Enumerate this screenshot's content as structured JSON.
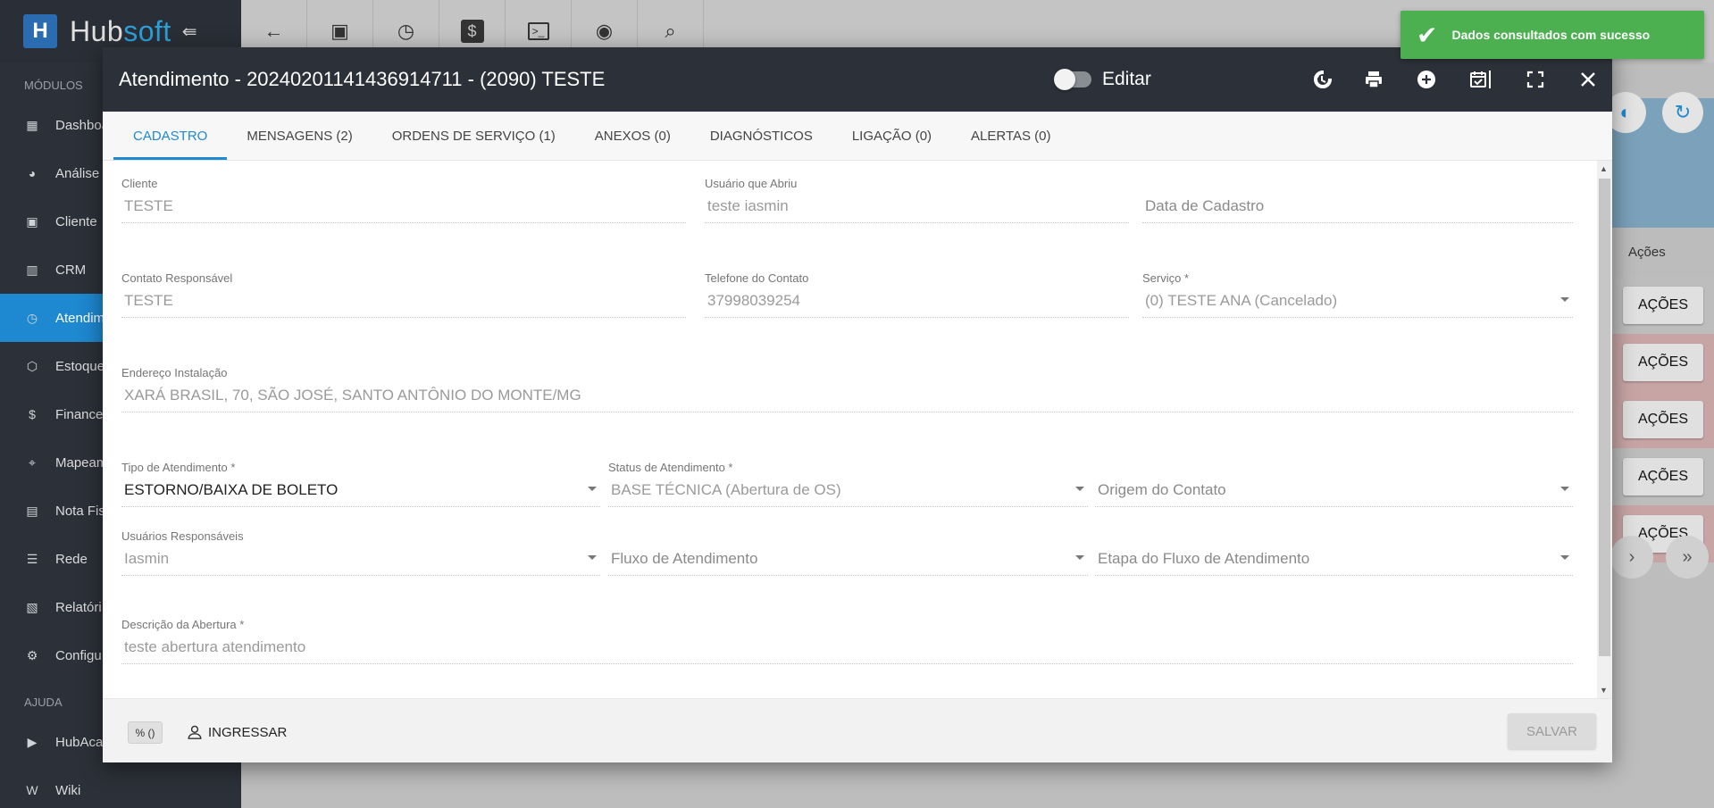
{
  "app": {
    "logo_letter": "H",
    "logo_text_a": "Hub",
    "logo_text_b": "soft",
    "collapse_icon": "collapse-left-icon"
  },
  "sidebar": {
    "modules_label": "MÓDULOS",
    "items": [
      {
        "label": "Dashboa",
        "icon": "dashboard-icon"
      },
      {
        "label": "Análise",
        "icon": "analytics-icon"
      },
      {
        "label": "Cliente",
        "icon": "contact-card-icon"
      },
      {
        "label": "CRM",
        "icon": "crm-board-icon"
      },
      {
        "label": "Atendim",
        "icon": "calendar-clock-icon",
        "active": true
      },
      {
        "label": "Estoque",
        "icon": "box-icon"
      },
      {
        "label": "Finance",
        "icon": "money-icon"
      },
      {
        "label": "Mapeam",
        "icon": "map-pin-icon"
      },
      {
        "label": "Nota Fis",
        "icon": "receipt-icon"
      },
      {
        "label": "Rede",
        "icon": "network-icon"
      },
      {
        "label": "Relatóri",
        "icon": "report-icon"
      },
      {
        "label": "Configu",
        "icon": "gear-icon"
      }
    ],
    "help_label": "AJUDA",
    "help_items": [
      {
        "label": "HubAca",
        "icon": "play-video-icon"
      },
      {
        "label": "Wiki",
        "icon": "wiki-icon"
      }
    ]
  },
  "toolbar": {
    "buttons": [
      "back-arrow-icon",
      "contact-icon",
      "calendar-clock-icon",
      "dollar-icon",
      "terminal-icon",
      "eye-icon",
      "search-icon"
    ]
  },
  "background": {
    "acoes_header": "Ações",
    "acoes_button": "AÇÕES"
  },
  "toast": {
    "message": "Dados consultados com sucesso"
  },
  "modal": {
    "title": "Atendimento - 20240201141436914711 - (2090) TESTE",
    "edit_label": "Editar",
    "edit_enabled": false,
    "header_icons": [
      "history-icon",
      "print-icon",
      "add-circle-icon",
      "calendar-check-icon",
      "fullscreen-icon",
      "close-icon"
    ],
    "tabs": [
      {
        "label": "CADASTRO",
        "active": true
      },
      {
        "label": "MENSAGENS (2)"
      },
      {
        "label": "ORDENS DE SERVIÇO (1)"
      },
      {
        "label": "ANEXOS (0)"
      },
      {
        "label": "DIAGNÓSTICOS"
      },
      {
        "label": "LIGAÇÃO (0)"
      },
      {
        "label": "ALERTAS (0)"
      }
    ],
    "fields": {
      "cliente": {
        "label": "Cliente",
        "value": "TESTE"
      },
      "usuario_abriu": {
        "label": "Usuário que Abriu",
        "value": "teste iasmin"
      },
      "data_cadastro": {
        "placeholder": "Data de Cadastro"
      },
      "contato": {
        "label": "Contato Responsável",
        "value": "TESTE"
      },
      "telefone": {
        "label": "Telefone do Contato",
        "value": "37998039254"
      },
      "servico": {
        "label": "Serviço *",
        "value": "(0) TESTE ANA (Cancelado)"
      },
      "endereco": {
        "label": "Endereço Instalação",
        "value": "XARÁ BRASIL, 70, SÃO JOSÉ, SANTO ANTÔNIO DO MONTE/MG"
      },
      "tipo": {
        "label": "Tipo de Atendimento *",
        "value": "ESTORNO/BAIXA DE BOLETO"
      },
      "status": {
        "label": "Status de Atendimento *",
        "value": "BASE TÉCNICA (Abertura de OS)"
      },
      "origem": {
        "placeholder": "Origem do Contato"
      },
      "usuarios": {
        "label": "Usuários Responsáveis",
        "value": "Iasmin"
      },
      "fluxo": {
        "placeholder": "Fluxo de Atendimento"
      },
      "etapa": {
        "placeholder": "Etapa do Fluxo de Atendimento"
      },
      "descricao": {
        "label": "Descrição da Abertura *",
        "value": "teste abertura atendimento"
      }
    },
    "footer": {
      "badge": "% ()",
      "ingressar": "INGRESSAR",
      "salvar": "SALVAR"
    }
  }
}
